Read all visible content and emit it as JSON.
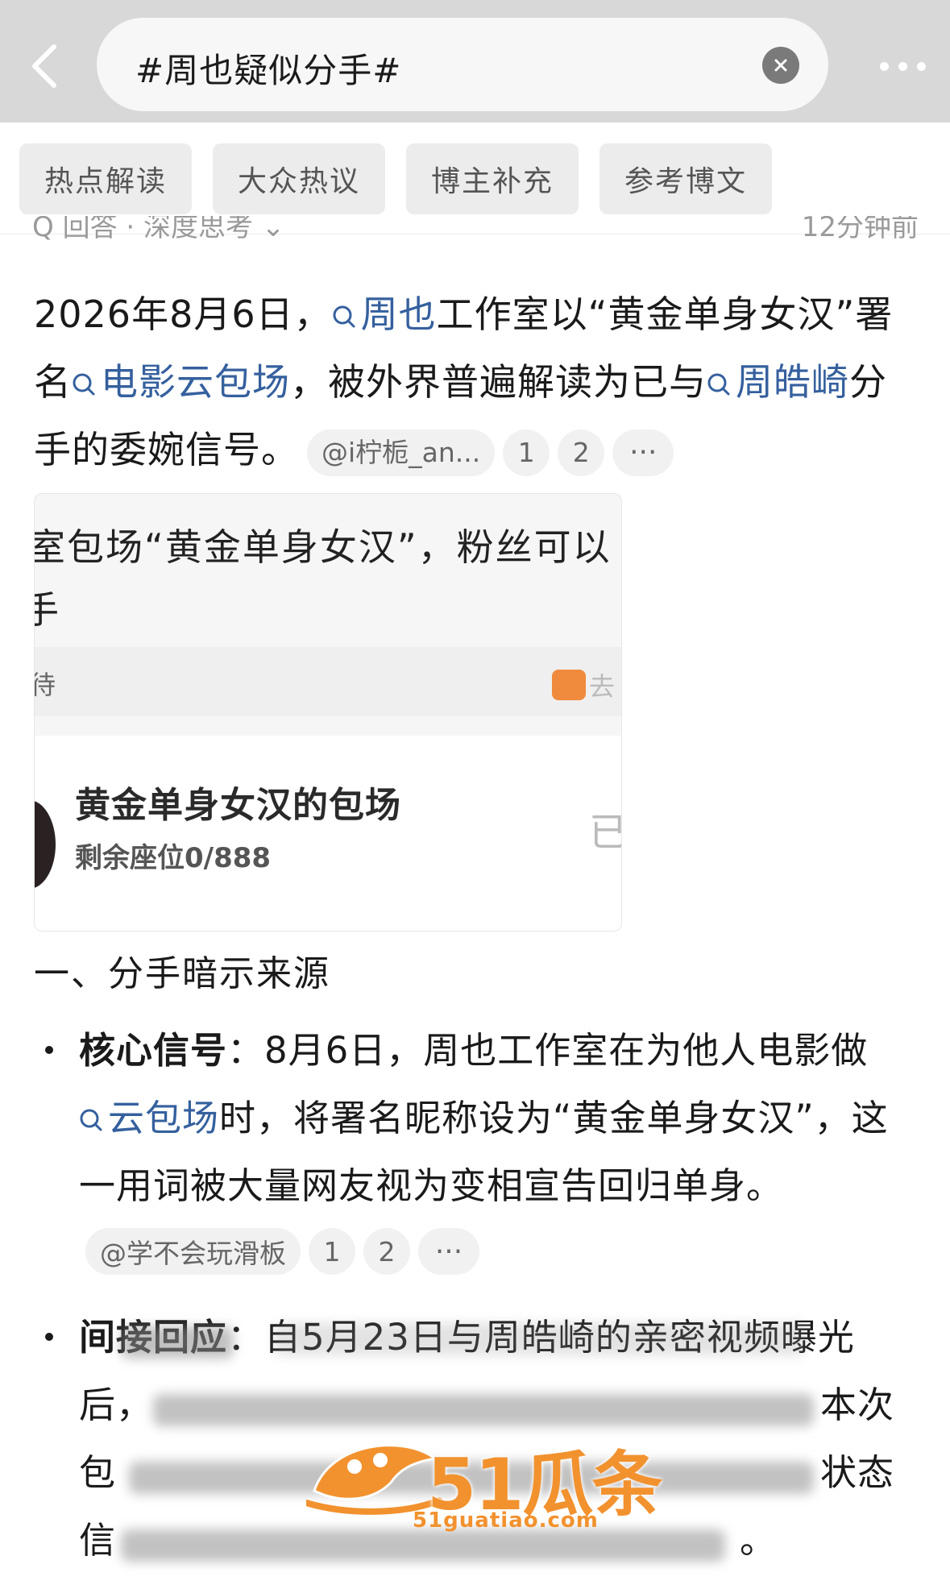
{
  "search": {
    "query": "#周也疑似分手#"
  },
  "tabs": [
    "热点解读",
    "大众热议",
    "博主补充",
    "参考博文"
  ],
  "peek_row": {
    "left": "Q 回答 · 深度思考 ⌄",
    "right": "12分钟前"
  },
  "intro": {
    "p1": "2026年8月6日，",
    "link1": "周也",
    "p2": "工作室以“黄金单身女汉”署名",
    "link2": "电影云包场",
    "p3": "，被外界普遍解读为已与",
    "link3": "周皓崎",
    "p4": "分手的委婉信号。",
    "source": "@i柠栀_an...",
    "refs": [
      "1",
      "2"
    ],
    "more": "···"
  },
  "embed_image": {
    "line1": "室包场“黄金单身女汉”，粉丝可以",
    "line2": "手",
    "line3": "待",
    "line3_right": "去",
    "card_title": "黄金单身女汉的包场",
    "card_sub": "剩余座位0/888",
    "card_right": "已"
  },
  "section_heading": "一、分手暗示来源",
  "items": [
    {
      "label": "核心信号",
      "colon": "：",
      "t1": "8月6日，周也工作室在为他人电影做",
      "link": "云包场",
      "t2": "时，将署名昵称设为“黄金单身女汉”，这一用词被大量网友视为变相宣告回归单身。",
      "source": "@学不会玩滑板",
      "refs": [
        "1",
        "2"
      ],
      "more": "···"
    },
    {
      "label": "间接回应",
      "colon": "：",
      "t_visible_1": "自5月23日与周皓崎的亲密视频曝光",
      "t_visible_2": "后，",
      "t_visible_2r": "本次",
      "t_visible_3": "包",
      "t_visible_3r": "状态",
      "t_visible_4": "信",
      "t_visible_4r": "。"
    }
  ],
  "watermark": {
    "brand": "51瓜条",
    "url": "51guatiao.com"
  },
  "colors": {
    "link": "#35609e",
    "watermark": "#f2922f",
    "topbar": "#d8d8d8"
  },
  "icons": [
    "back-chevron-icon",
    "clear-icon",
    "more-icon",
    "search-link-icon"
  ]
}
